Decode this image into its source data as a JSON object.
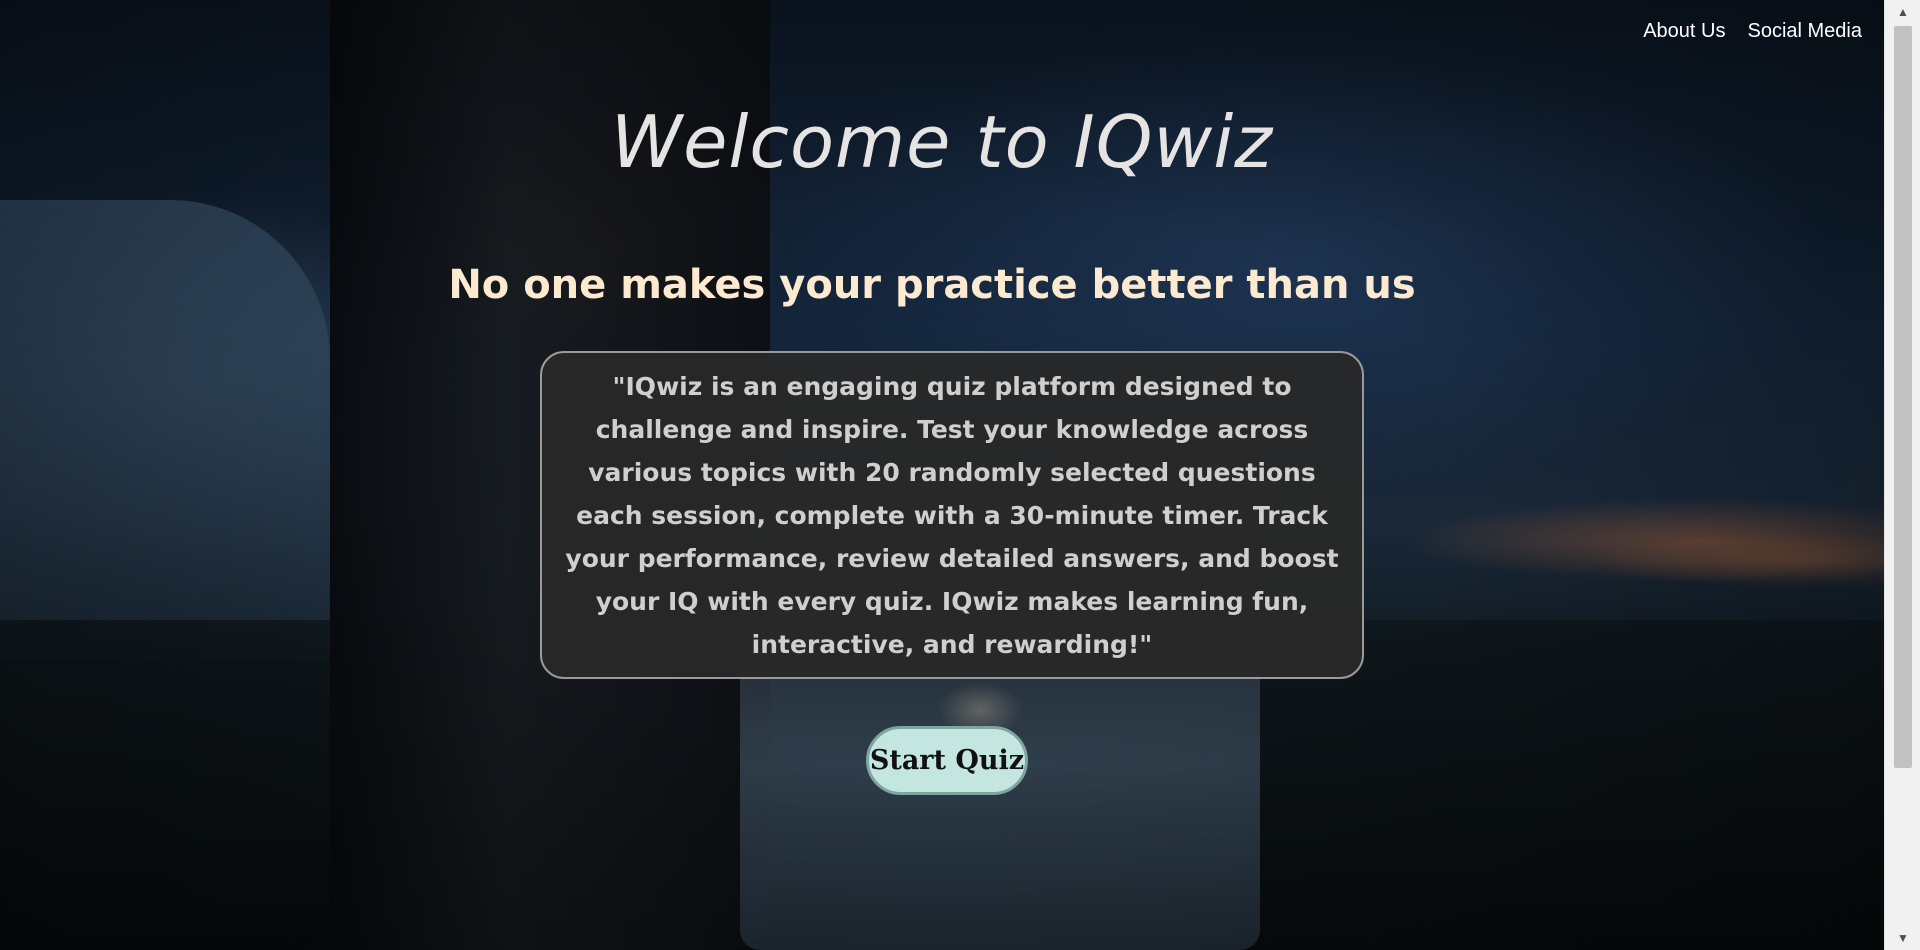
{
  "nav": {
    "about_label": "About Us",
    "social_label": "Social Media"
  },
  "hero": {
    "title": "Welcome to IQwiz",
    "subtitle": "No one makes your practice better than us",
    "description": "\"IQwiz is an engaging quiz platform designed to challenge and inspire. Test your knowledge across various topics with 20 randomly selected questions each session, complete with a 30-minute timer. Track your performance, review detailed answers, and boost your IQ with every quiz. IQwiz makes learning fun, interactive, and rewarding!\"",
    "start_button_label": "Start Quiz"
  },
  "scrollbar": {
    "up_icon": "▲",
    "down_icon": "▼"
  },
  "colors": {
    "title": "#e6e3e3",
    "subtitle": "#fbe9d0",
    "box_bg": "#282828",
    "button_bg": "#c3e6e1"
  }
}
